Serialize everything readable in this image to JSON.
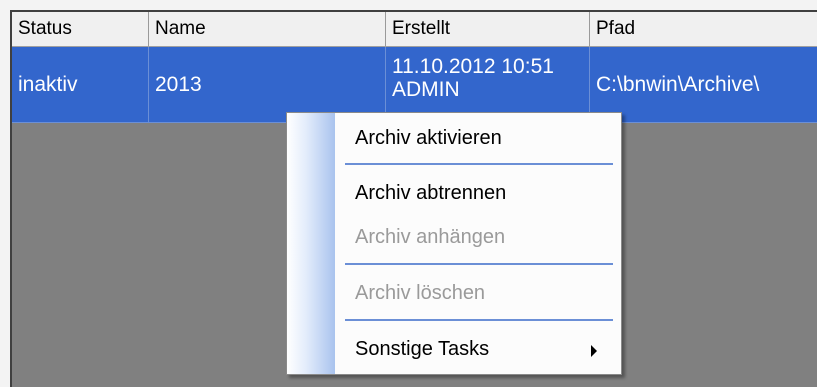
{
  "table": {
    "columns": [
      "Status",
      "Name",
      "Erstellt",
      "Pfad"
    ],
    "rows": [
      {
        "status": "inaktiv",
        "name": "2013",
        "erstellt_line1": "11.10.2012 10:51",
        "erstellt_line2": "ADMIN",
        "pfad": "C:\\bnwin\\Archive\\"
      }
    ]
  },
  "context_menu": {
    "items": [
      {
        "label": "Archiv aktivieren",
        "enabled": true
      },
      {
        "label": "Archiv abtrennen",
        "enabled": true
      },
      {
        "label": "Archiv anhängen",
        "enabled": false
      },
      {
        "label": "Archiv löschen",
        "enabled": false
      },
      {
        "label": "Sonstige Tasks",
        "enabled": true,
        "submenu": true
      }
    ]
  },
  "colors": {
    "selection": "#3366cc",
    "grid_background": "#808080",
    "menu_separator": "#6b8fd6",
    "disabled_text": "#9a9a9a"
  }
}
